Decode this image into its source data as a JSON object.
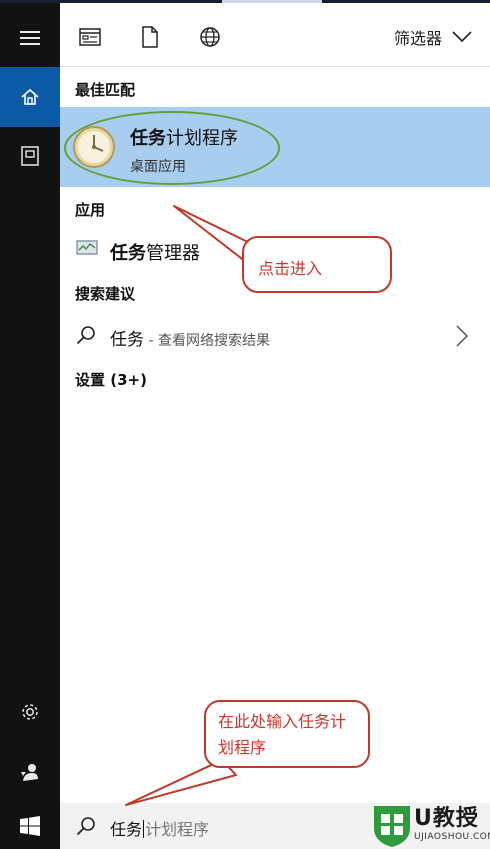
{
  "toolbar": {
    "icons": [
      "apps-icon",
      "document-icon",
      "web-icon"
    ],
    "filter_label": "筛选器"
  },
  "sidebar": {
    "icons": [
      "hamburger-menu-icon",
      "home-icon",
      "documents-icon",
      "settings-icon",
      "feedback-icon",
      "windows-start-icon"
    ],
    "active": "home-icon"
  },
  "sections": {
    "best_match": "最佳匹配",
    "apps": "应用",
    "search_suggestions": "搜索建议",
    "settings": "设置 (3+)"
  },
  "best_match": {
    "title_bold": "任务",
    "title_rest": "计划程序",
    "subtitle": "桌面应用",
    "icon": "clock-icon"
  },
  "apps": [
    {
      "label_bold": "任务",
      "label_rest": "管理器",
      "icon": "task-manager-icon"
    }
  ],
  "suggestion": {
    "query": "任务",
    "hint": " - 查看网络搜索结果"
  },
  "search": {
    "typed": "任务",
    "ghost": "计划程序"
  },
  "annotations": {
    "click_enter": "点击进入",
    "type_here": "在此处输入任务计划程序"
  },
  "watermark": {
    "brand": "U教授",
    "site": "UJIAOSHOU.COM"
  },
  "colors": {
    "accent": "#0c5aa6",
    "highlight": "#a8cdee",
    "annotation": "#c0392b",
    "ring": "#5fa03a"
  }
}
